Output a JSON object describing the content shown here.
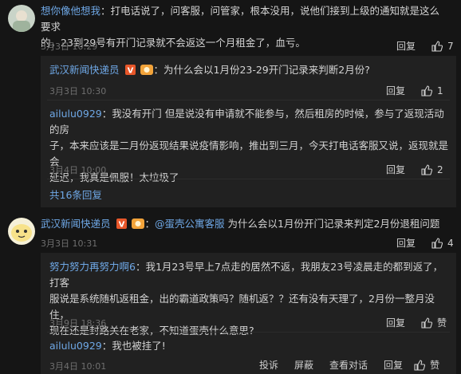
{
  "c1": {
    "user": "想你像他想我",
    "text_line1": "：打电话说了，问客服，问管家，根本没用，说他们接到上级的通知就是这么要求",
    "text_line2": "的，23到29号有开门记录就不会返这一个月租金了，血亏。",
    "time": "3月3日 10:29",
    "reply": "回复",
    "likes": "7"
  },
  "r1": {
    "user": "武汉新闻快递员",
    "text": "：为什么会以1月份23-29开门记录来判断2月份?",
    "time": "3月3日 10:30",
    "reply": "回复",
    "likes": "1"
  },
  "r2": {
    "user": "ailulu0929",
    "text_line1": "：我没有开门 但是说没有申请就不能参与，然后租房的时候，参与了返现活动的房",
    "text_line2": "子，本来应该是二月份返现结果说疫情影响，推出到三月，今天打电话客服又说，返现就是会",
    "text_line3": "延迟，我真是佩服！太垃圾了",
    "time": "3月4日 10:00",
    "reply": "回复",
    "likes": "2"
  },
  "more1": "共16条回复",
  "c2": {
    "user": "武汉新闻快递员",
    "mention": "@蛋壳公寓客服",
    "text": " 为什么会以1月份开门记录来判定2月份退租问题",
    "time": "3月3日 10:31",
    "reply": "回复",
    "likes": "4"
  },
  "r3": {
    "user": "努力努力再努力啊6",
    "text_line1": "：我1月23号早上7点走的居然不返，我朋友23号凌晨走的都到返了，打客",
    "text_line2": "服说是系统随机返租金，出的霸道政策吗？随机返？？还有没有天理了，2月份一整月没住，",
    "text_line3": "现在还是封路关在老家，不知道蛋壳什么意思?",
    "time": "3月9日 18:36",
    "reply": "回复",
    "likes": "赞"
  },
  "r4": {
    "user": "ailulu0929",
    "text": "：我也被挂了!",
    "time": "3月4日 10:01",
    "actions": [
      "投诉",
      "屏蔽",
      "查看对话",
      "回复"
    ],
    "likes": "赞"
  }
}
